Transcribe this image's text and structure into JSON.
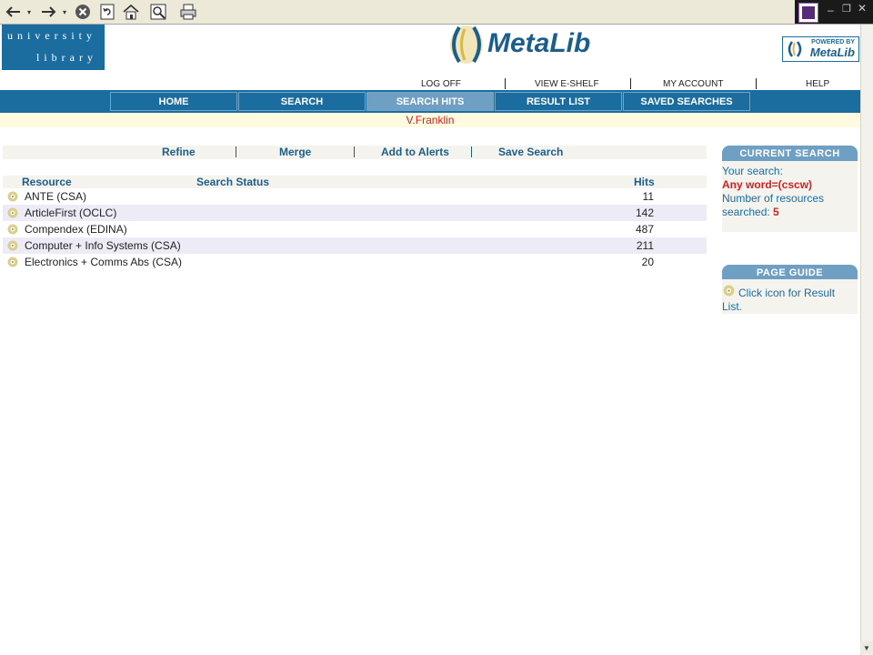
{
  "colors": {
    "brand_blue": "#1b6c9f",
    "nav_active": "#6fa0c4",
    "user_highlight": "#d81e1e",
    "row_alt": "#ecebf6",
    "panel_bg": "#f4f3ee"
  },
  "header": {
    "uni_logo_line1": "university",
    "uni_logo_line2": "library",
    "metalib_logo": "MetaLib",
    "powered_line1": "POWERED BY",
    "powered_line2": "MetaLib"
  },
  "top_links": {
    "log_off": "LOG OFF",
    "view_eshelf": "VIEW E-SHELF",
    "my_account": "MY ACCOUNT",
    "help": "HELP"
  },
  "nav": {
    "home": "HOME",
    "search": "SEARCH",
    "search_hits": "SEARCH HITS",
    "result_list": "RESULT LIST",
    "saved_searches": "SAVED SEARCHES"
  },
  "user": {
    "name": "V.Franklin"
  },
  "actions": {
    "refine": "Refine",
    "merge": "Merge",
    "add_to_alerts": "Add to Alerts",
    "save_search": "Save Search"
  },
  "table": {
    "headers": {
      "resource": "Resource",
      "status": "Search Status",
      "hits": "Hits"
    },
    "rows": [
      {
        "name": "ANTE (CSA)",
        "hits": "11"
      },
      {
        "name": "ArticleFirst (OCLC)",
        "hits": "142"
      },
      {
        "name": "Compendex (EDINA)",
        "hits": "487"
      },
      {
        "name": "Computer + Info Systems (CSA)",
        "hits": "211"
      },
      {
        "name": "Electronics + Comms Abs (CSA)",
        "hits": "20"
      }
    ]
  },
  "current_search": {
    "title": "CURRENT SEARCH",
    "your_search": "Your search:",
    "query": "Any word=(cscw)",
    "resources_line1": "Number of resources",
    "resources_line2": "searched:",
    "resources_count": "5"
  },
  "page_guide": {
    "title": "PAGE GUIDE",
    "text": "Click icon for Result List."
  },
  "icons": {
    "back": "back-arrow-icon",
    "forward": "forward-arrow-icon",
    "stop": "stop-icon",
    "refresh": "refresh-icon",
    "home": "home-icon",
    "search": "search-icon",
    "print": "print-icon",
    "result": "result-list-icon"
  }
}
